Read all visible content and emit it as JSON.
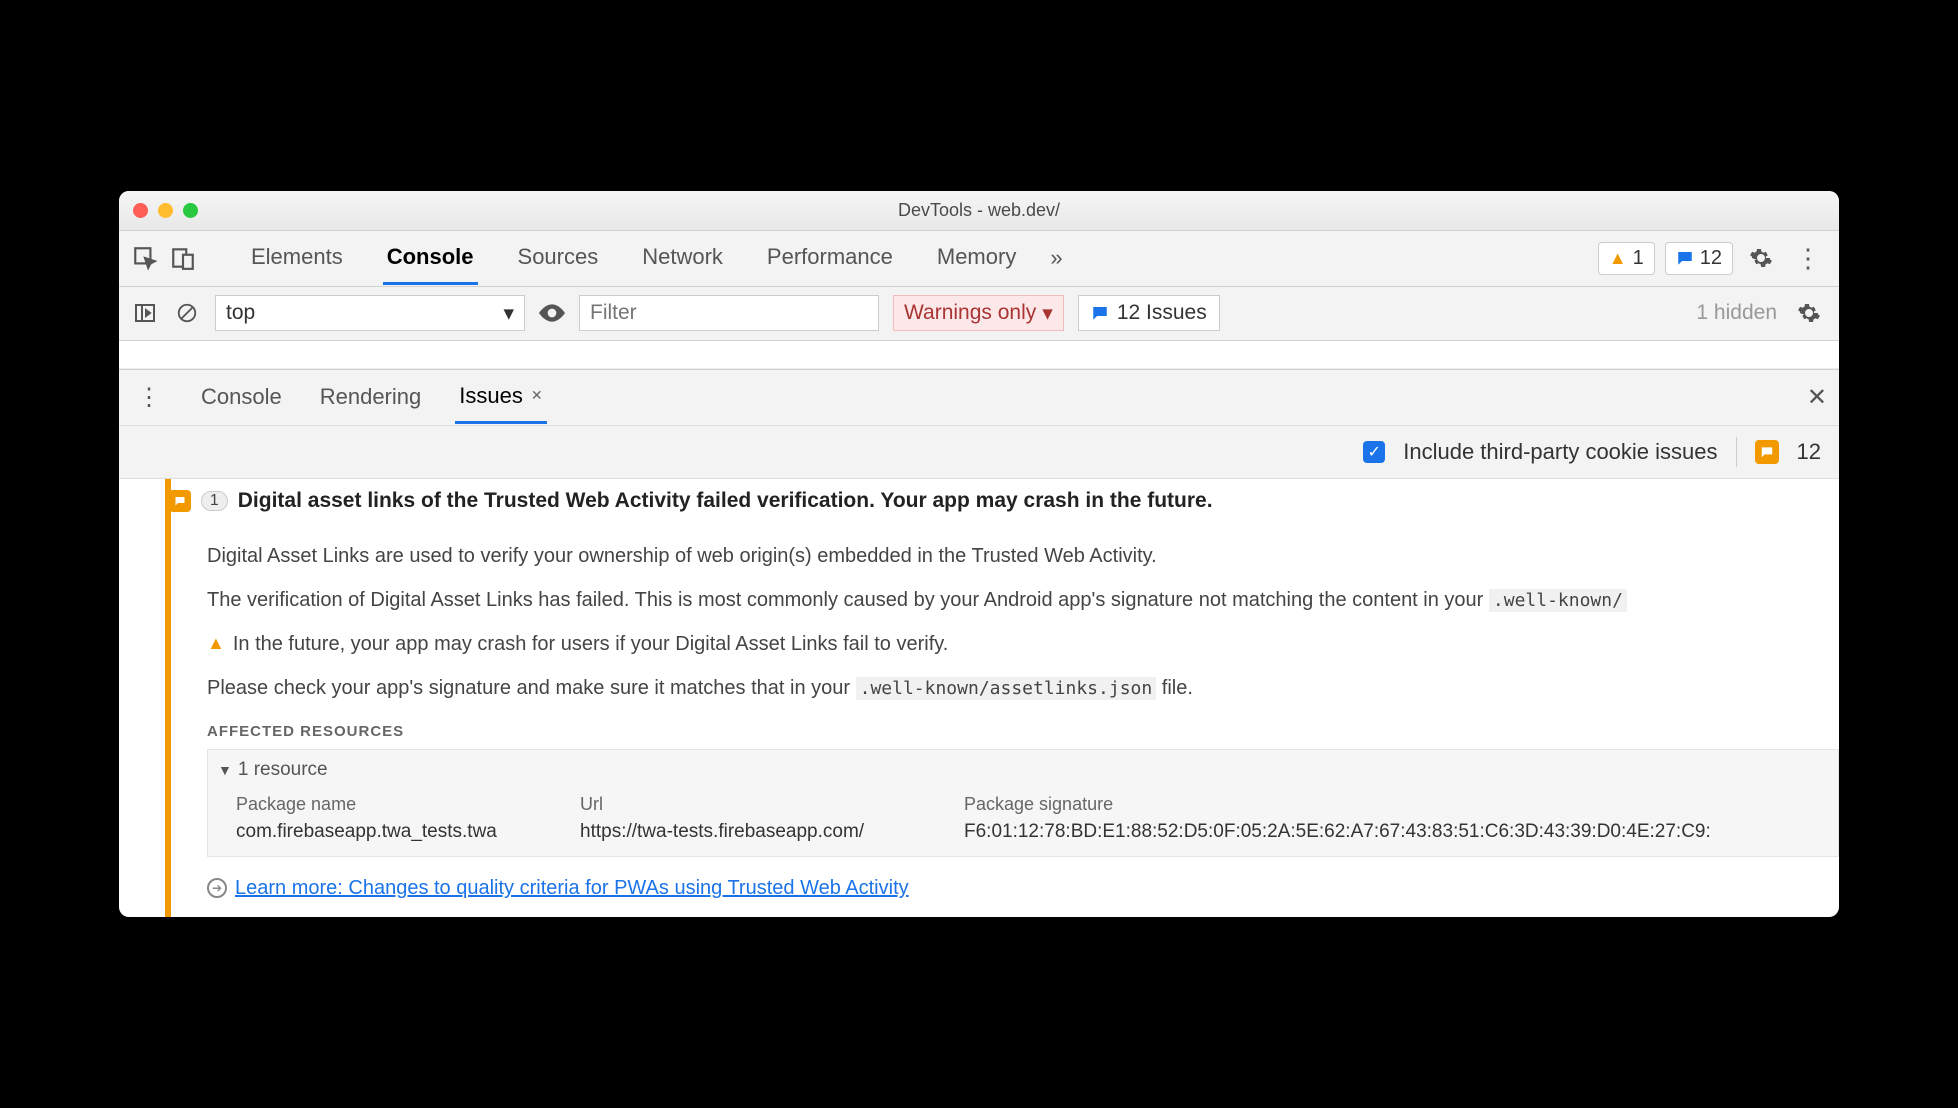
{
  "window": {
    "title": "DevTools - web.dev/"
  },
  "toolbar": {
    "tabs": [
      "Elements",
      "Console",
      "Sources",
      "Network",
      "Performance",
      "Memory"
    ],
    "active_tab": "Console",
    "warn_badge": "1",
    "issue_badge": "12"
  },
  "filterbar": {
    "context": "top",
    "filter_placeholder": "Filter",
    "level": "Warnings only",
    "issues_btn": "12 Issues",
    "hidden": "1 hidden"
  },
  "drawer": {
    "tabs": [
      "Console",
      "Rendering",
      "Issues"
    ],
    "active_tab": "Issues"
  },
  "issues_bar": {
    "checkbox_label": "Include third-party cookie issues",
    "count": "12"
  },
  "issue": {
    "count": "1",
    "title": "Digital asset links of the Trusted Web Activity failed verification. Your app may crash in the future.",
    "p1": "Digital Asset Links are used to verify your ownership of web origin(s) embedded in the Trusted Web Activity.",
    "p2_a": "The verification of Digital Asset Links has failed. This is most commonly caused by your Android app's signature not matching the content in your ",
    "p2_code": ".well-known/",
    "p3": "In the future, your app may crash for users if your Digital Asset Links fail to verify.",
    "p4_a": "Please check your app's signature and make sure it matches that in your ",
    "p4_code": ".well-known/assetlinks.json",
    "p4_b": " file.",
    "affected_header": "AFFECTED RESOURCES",
    "resource_count": "1 resource",
    "table": {
      "h1": "Package name",
      "h2": "Url",
      "h3": "Package signature",
      "c1": "com.firebaseapp.twa_tests.twa",
      "c2": "https://twa-tests.firebaseapp.com/",
      "c3": "F6:01:12:78:BD:E1:88:52:D5:0F:05:2A:5E:62:A7:67:43:83:51:C6:3D:43:39:D0:4E:27:C9:"
    },
    "learn_more": "Learn more: Changes to quality criteria for PWAs using Trusted Web Activity"
  }
}
